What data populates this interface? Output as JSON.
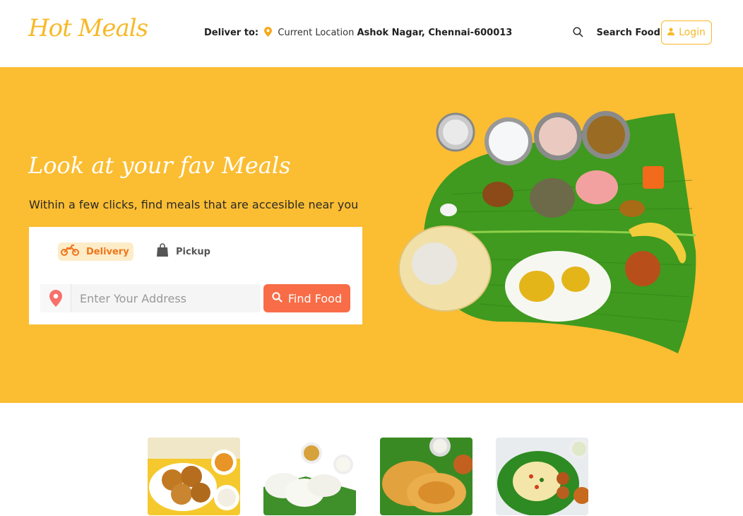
{
  "header": {
    "logo": "Hot Meals",
    "deliver_label": "Deliver to:",
    "current_location": "Current Location",
    "address": "Ashok Nagar, Chennai-600013",
    "search_label": "Search Food",
    "login_label": "Login"
  },
  "hero": {
    "title": "Look at your fav Meals",
    "subtitle": "Within a few clicks, find meals that are accesible near you",
    "tabs": [
      {
        "label": "Delivery",
        "active": true
      },
      {
        "label": "Pickup",
        "active": false
      }
    ],
    "address_placeholder": "Enter Your Address",
    "find_button": "Find Food"
  },
  "colors": {
    "brand_yellow": "#fbbd32",
    "accent_orange": "#f86d48",
    "logo": "#f7b928"
  },
  "thumbnails": [
    {
      "icon": "vada-image"
    },
    {
      "icon": "idli-image"
    },
    {
      "icon": "parotta-image"
    },
    {
      "icon": "uttapam-image"
    }
  ]
}
